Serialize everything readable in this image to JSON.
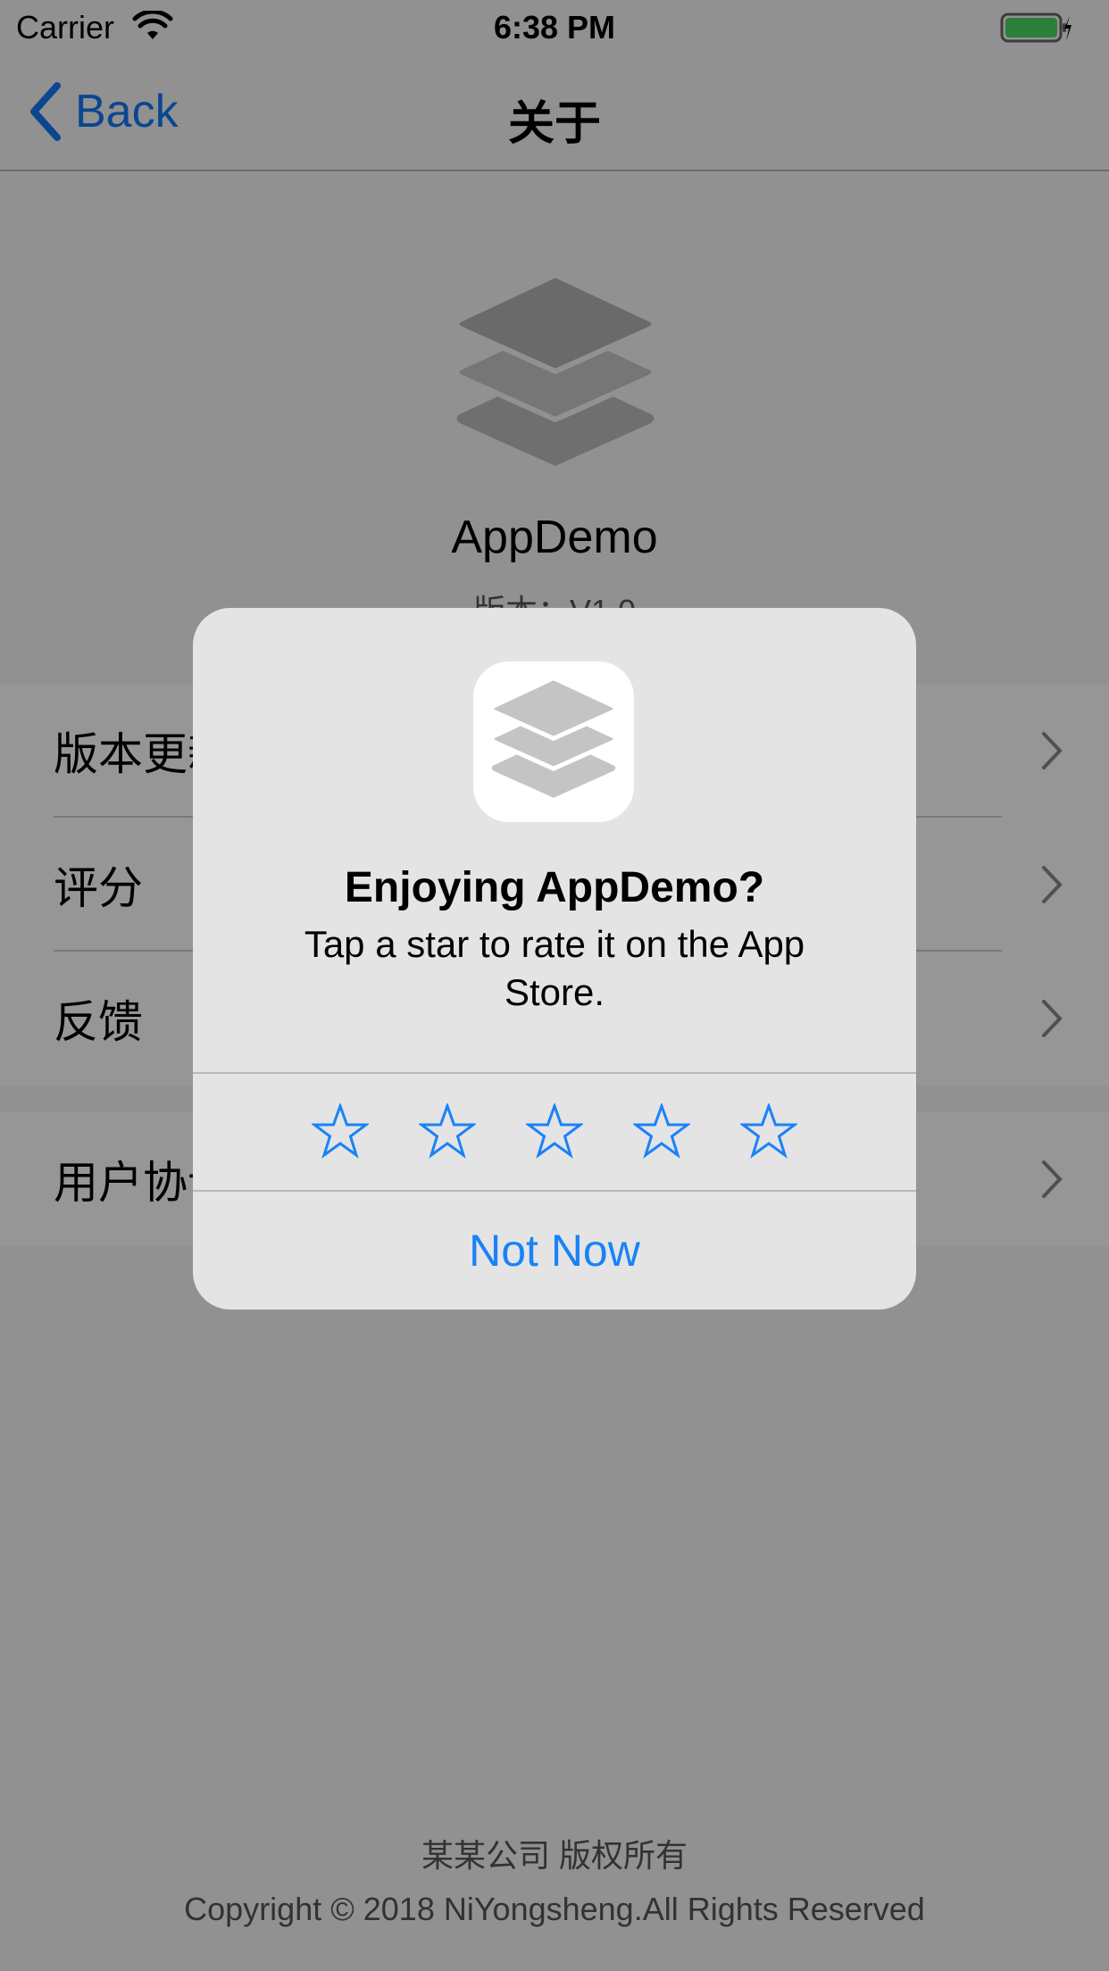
{
  "status_bar": {
    "carrier": "Carrier",
    "time": "6:38 PM",
    "battery_color": "#4cd964"
  },
  "nav": {
    "back_label": "Back",
    "title": "关于",
    "accent_color": "#1478f5"
  },
  "header": {
    "app_name": "AppDemo",
    "version": "版本：V1.0",
    "logo_icon": "layers-icon"
  },
  "groups": [
    {
      "items": [
        {
          "label": "版本更新"
        },
        {
          "label": "评分"
        },
        {
          "label": "反馈"
        }
      ]
    },
    {
      "items": [
        {
          "label": "用户协议"
        }
      ]
    }
  ],
  "footer": {
    "company": "某某公司 版权所有",
    "copyright": "Copyright © 2018 NiYongsheng.All Rights Reserved"
  },
  "rating_alert": {
    "title": "Enjoying AppDemo?",
    "message": "Tap a star to rate it on the App Store.",
    "stars": 5,
    "selected_stars": 0,
    "not_now_label": "Not Now",
    "star_icon": "star-outline-icon"
  }
}
